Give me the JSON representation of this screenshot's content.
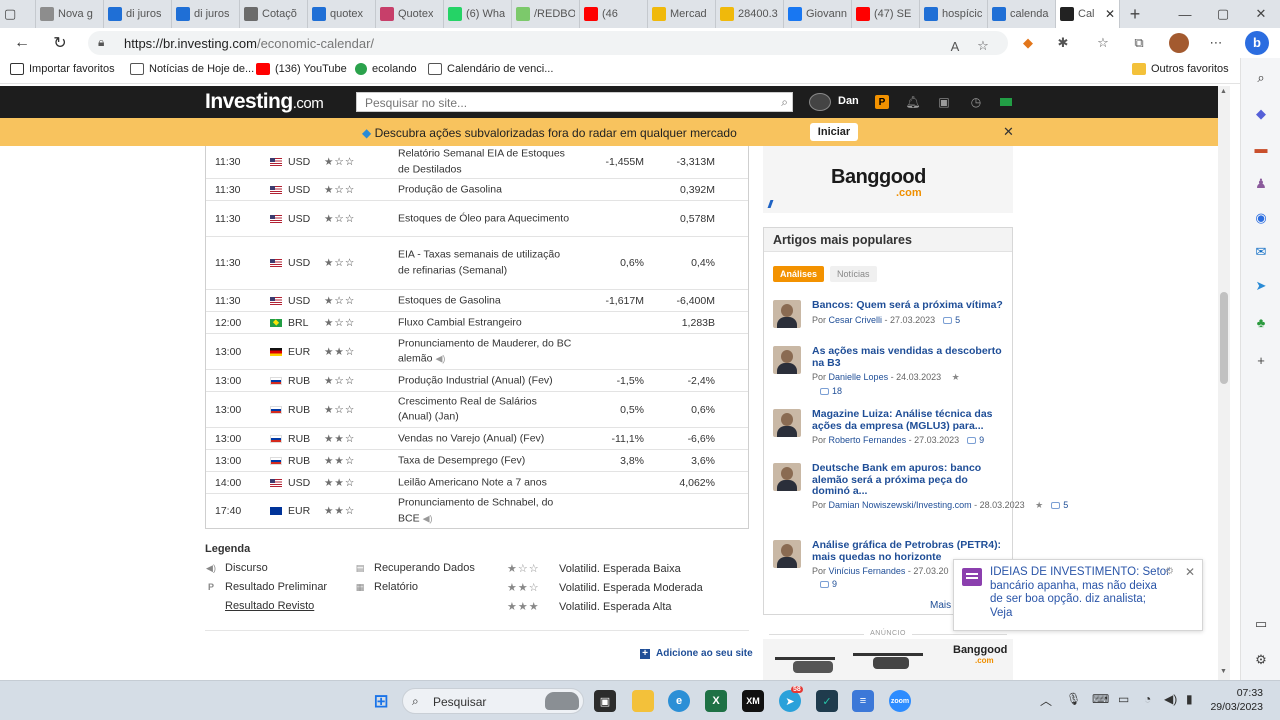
{
  "browser": {
    "tabs": [
      {
        "label": "Nova g",
        "icon": "page-icon",
        "color": "#8d8d8d"
      },
      {
        "label": "di juros",
        "icon": "search-icon",
        "color": "#1f6fd6"
      },
      {
        "label": "di juros",
        "icon": "search-icon",
        "color": "#1f6fd6"
      },
      {
        "label": "Cotaçõ",
        "icon": "im-icon",
        "color": "#6b6b6b"
      },
      {
        "label": "quotex",
        "icon": "search-icon",
        "color": "#1f6fd6"
      },
      {
        "label": "Quotex",
        "icon": "quotex-icon",
        "color": "#c73f6a"
      },
      {
        "label": "(6) Wha",
        "icon": "whatsapp-icon",
        "color": "#25d366"
      },
      {
        "label": "/REDBO",
        "icon": "play-icon",
        "color": "#7cc96b"
      },
      {
        "label": "(46",
        "icon": "youtube-icon",
        "color": "#ff0000"
      },
      {
        "label": "Mercad",
        "icon": "binance-icon",
        "color": "#f0b90b"
      },
      {
        "label": "28400.3",
        "icon": "binance-icon",
        "color": "#f0b90b"
      },
      {
        "label": "Giovann",
        "icon": "facebook-icon",
        "color": "#1877f2"
      },
      {
        "label": "(47) SE",
        "icon": "youtube-icon",
        "color": "#ff0000"
      },
      {
        "label": "hospícic",
        "icon": "search-icon",
        "color": "#1f6fd6"
      },
      {
        "label": "calenda",
        "icon": "search-icon",
        "color": "#1f6fd6"
      },
      {
        "label": "Cal",
        "icon": "investing-icon",
        "color": "#222222",
        "active": true
      }
    ],
    "url_host": "https://br.investing.com",
    "url_path": "/economic-calendar/",
    "bookmarks": [
      {
        "label": "Importar favoritos",
        "icon": "import-icon",
        "color": "#333333"
      },
      {
        "label": "Notícias de Hoje de...",
        "icon": "page-icon",
        "color": "#555555"
      },
      {
        "label": "(136) YouTube",
        "icon": "youtube-icon",
        "color": "#ff0000"
      },
      {
        "label": "ecolando",
        "icon": "ecolando-icon",
        "color": "#2ba24c"
      },
      {
        "label": "Calendário de venci...",
        "icon": "page-icon",
        "color": "#555555"
      }
    ],
    "other_favorites": "Outros favoritos"
  },
  "site": {
    "logo": "Investing",
    "logo_suffix": ".com",
    "search_placeholder": "Pesquisar no site...",
    "user_name": "Dan",
    "banner_text": "Descubra ações subvalorizadas fora do radar em qualquer mercado",
    "banner_button": "Iniciar"
  },
  "calendar": [
    {
      "time": "11:30",
      "flag": "us",
      "currency": "USD",
      "stars": 1,
      "event": "Relatório Semanal EIA de Estoques de Destilados",
      "actual": "-1,455M",
      "previous": "-3,313M",
      "h": 32
    },
    {
      "time": "11:30",
      "flag": "us",
      "currency": "USD",
      "stars": 1,
      "event": "Produção de Gasolina",
      "actual": "",
      "previous": "0,392M",
      "h": 22
    },
    {
      "time": "11:30",
      "flag": "us",
      "currency": "USD",
      "stars": 1,
      "event": "Estoques de Óleo para Aquecimento",
      "actual": "",
      "previous": "0,578M",
      "h": 36
    },
    {
      "time": "11:30",
      "flag": "us",
      "currency": "USD",
      "stars": 1,
      "event": "EIA - Taxas semanais de utilização de refinarias (Semanal)",
      "actual": "0,6%",
      "previous": "0,4%",
      "h": 53
    },
    {
      "time": "11:30",
      "flag": "us",
      "currency": "USD",
      "stars": 1,
      "event": "Estoques de Gasolina",
      "actual": "-1,617M",
      "previous": "-6,400M",
      "h": 22
    },
    {
      "time": "12:00",
      "flag": "br",
      "currency": "BRL",
      "stars": 1,
      "event": "Fluxo Cambial Estrangeiro",
      "actual": "",
      "previous": "1,283B",
      "h": 22
    },
    {
      "time": "13:00",
      "flag": "de",
      "currency": "EUR",
      "stars": 2,
      "event": "Pronunciamento de Mauderer, do BC alemão",
      "speech": true,
      "actual": "",
      "previous": "",
      "h": 36
    },
    {
      "time": "13:00",
      "flag": "ru",
      "currency": "RUB",
      "stars": 1,
      "event": "Produção Industrial (Anual) (Fev)",
      "actual": "-1,5%",
      "previous": "-2,4%",
      "h": 22
    },
    {
      "time": "13:00",
      "flag": "ru",
      "currency": "RUB",
      "stars": 1,
      "event": "Crescimento Real de Salários (Anual) (Jan)",
      "actual": "0,5%",
      "previous": "0,6%",
      "h": 36
    },
    {
      "time": "13:00",
      "flag": "ru",
      "currency": "RUB",
      "stars": 2,
      "event": "Vendas no Varejo (Anual) (Fev)",
      "actual": "-11,1%",
      "previous": "-6,6%",
      "h": 22
    },
    {
      "time": "13:00",
      "flag": "ru",
      "currency": "RUB",
      "stars": 2,
      "event": "Taxa de Desemprego (Fev)",
      "actual": "3,8%",
      "previous": "3,6%",
      "h": 22
    },
    {
      "time": "14:00",
      "flag": "us",
      "currency": "USD",
      "stars": 2,
      "event": "Leilão Americano Note a 7 anos",
      "actual": "",
      "previous": "4,062%",
      "h": 22
    },
    {
      "time": "17:40",
      "flag": "eu",
      "currency": "EUR",
      "stars": 2,
      "event": "Pronunciamento de Schnabel, do BCE",
      "speech": true,
      "actual": "",
      "previous": "",
      "h": 35
    }
  ],
  "legend": {
    "title": "Legenda",
    "items": [
      {
        "label": "Discurso",
        "icon": "speaker-icon"
      },
      {
        "label": "Resultado Preliminar",
        "icon": "p-icon"
      },
      {
        "label": "Resultado Revisto",
        "icon": ""
      },
      {
        "label": "Recuperando Dados",
        "icon": "document-icon"
      },
      {
        "label": "Relatório",
        "icon": "report-icon"
      },
      {
        "label": "Volatilid. Esperada Baixa",
        "stars": 1
      },
      {
        "label": "Volatilid. Esperada Moderada",
        "stars": 2
      },
      {
        "label": "Volatilid. Esperada Alta",
        "stars": 3
      }
    ],
    "add_site": "Adicione ao seu site"
  },
  "ad": {
    "brand": "Banggood",
    "suffix": ".com",
    "label": "ANÚNCIO"
  },
  "popular": {
    "title": "Artigos mais populares",
    "tabs": [
      "Análises",
      "Notícias"
    ],
    "articles": [
      {
        "title": "Bancos: Quem será a próxima vítima?",
        "author": "Cesar Crivelli",
        "date": "27.03.2023",
        "comments": "5",
        "star": false
      },
      {
        "title": "As ações mais vendidas a descoberto na B3",
        "author": "Danielle Lopes",
        "date": "24.03.2023",
        "comments": "18",
        "star": true
      },
      {
        "title": "Magazine Luiza: Análise técnica das ações da empresa (MGLU3) para...",
        "author": "Roberto Fernandes",
        "date": "27.03.2023",
        "comments": "9",
        "star": false
      },
      {
        "title": "Deutsche Bank em apuros: banco alemão será a próxima peça do dominó a...",
        "author": "Damian Nowiszewski/Investing.com",
        "date": "28.03.2023",
        "comments": "5",
        "star": true
      },
      {
        "title": "Análise gráfica de Petrobras (PETR4): mais quedas no horizonte",
        "author": "Vinícius Fernandes",
        "date": "27.03.20",
        "comments": "9",
        "star": false
      }
    ],
    "by": "Por",
    "more": "Mais"
  },
  "toast": {
    "text": "IDEIAS DE INVESTIMENTO: Setor bancário apanha, mas não deixa de ser boa opção. diz analista; Veja"
  },
  "taskbar": {
    "search": "Pesquisar",
    "time": "07:33",
    "date": "29/03/2023",
    "telegram_badge": "58"
  }
}
